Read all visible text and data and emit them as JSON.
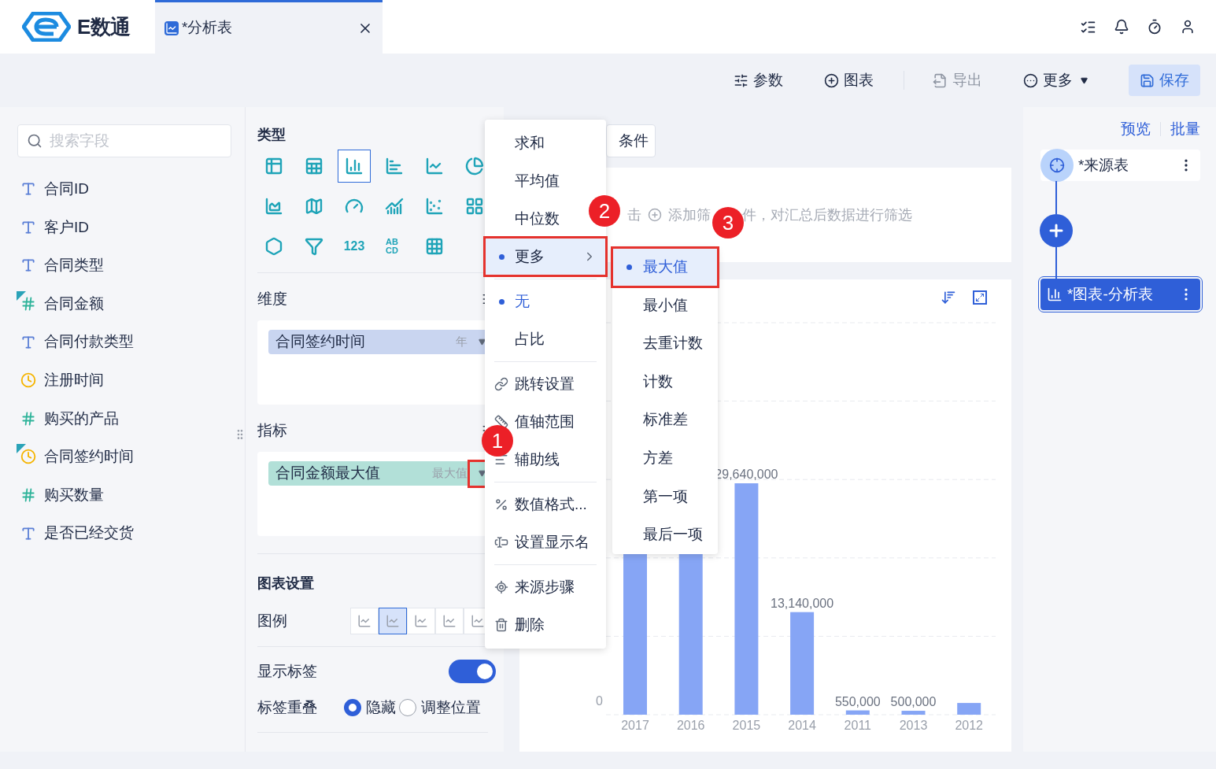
{
  "app": {
    "logo_text": "E数通"
  },
  "tabs": [
    {
      "label": "*分析表",
      "selected": true
    }
  ],
  "toolbar": {
    "buttons": [
      {
        "label": "参数",
        "kind": "params",
        "disabled": false
      },
      {
        "label": "图表",
        "kind": "add",
        "disabled": false
      },
      {
        "label": "导出",
        "kind": "export",
        "disabled": true
      },
      {
        "label": "更多",
        "kind": "more",
        "disabled": false
      },
      {
        "label": "保存",
        "kind": "save",
        "disabled": false
      }
    ]
  },
  "fields_panel": {
    "search": {
      "placeholder": "搜索字段"
    },
    "fields": [
      {
        "name": "合同ID",
        "kind": "text",
        "used": false
      },
      {
        "name": "客户ID",
        "kind": "text",
        "used": false
      },
      {
        "name": "合同类型",
        "kind": "text",
        "used": false
      },
      {
        "name": "合同金额",
        "kind": "number",
        "used": true
      },
      {
        "name": "合同付款类型",
        "kind": "text",
        "used": false
      },
      {
        "name": "注册时间",
        "kind": "date",
        "used": false
      },
      {
        "name": "购买的产品",
        "kind": "number",
        "used": false
      },
      {
        "name": "合同签约时间",
        "kind": "date",
        "used": true
      },
      {
        "name": "购买数量",
        "kind": "number",
        "used": false
      },
      {
        "name": "是否已经交货",
        "kind": "text",
        "used": false
      }
    ]
  },
  "config": {
    "type_title": "类型",
    "chart_types": [
      {
        "kind": "table",
        "selected": false
      },
      {
        "kind": "crosstable",
        "selected": false
      },
      {
        "kind": "column",
        "selected": true
      },
      {
        "kind": "bar",
        "selected": false
      },
      {
        "kind": "line",
        "selected": false
      },
      {
        "kind": "pie",
        "selected": false
      },
      {
        "kind": "area",
        "selected": false
      },
      {
        "kind": "map",
        "selected": false
      },
      {
        "kind": "gauge",
        "selected": false
      },
      {
        "kind": "combo",
        "selected": false
      },
      {
        "kind": "scatter",
        "selected": false
      },
      {
        "kind": "treemap",
        "selected": false
      },
      {
        "kind": "radar",
        "selected": false
      },
      {
        "kind": "funnel",
        "selected": false
      },
      {
        "kind": "number",
        "glyph": "123",
        "selected": false
      },
      {
        "kind": "wordcloud",
        "glyph": "ABCD",
        "selected": false
      },
      {
        "kind": "heatmap",
        "selected": false
      }
    ],
    "dimension": {
      "title": "维度",
      "pill": {
        "label": "合同签约时间",
        "detail": "年",
        "highlighted": false
      }
    },
    "measure": {
      "title": "指标",
      "pill": {
        "label": "合同金额最大值",
        "detail": "最大值",
        "highlighted": true
      }
    },
    "chart_settings": {
      "title": "图表设置",
      "legend": {
        "label": "图例",
        "options": [
          {
            "selected": false
          },
          {
            "selected": true
          },
          {
            "selected": false
          },
          {
            "selected": false
          },
          {
            "selected": false
          }
        ]
      },
      "show_labels": {
        "label": "显示标签",
        "on": true
      },
      "label_overlap": {
        "label": "标签重叠",
        "options": [
          {
            "label": "隐藏",
            "selected": true
          },
          {
            "label": "调整位置",
            "selected": false
          }
        ]
      }
    }
  },
  "filter": {
    "button": "条件",
    "hint_parts": [
      "击",
      "添加筛",
      "件，对汇总后数据进行筛选"
    ]
  },
  "chart": {
    "chart_data": {
      "type": "bar",
      "categories": [
        "2017",
        "2016",
        "2015",
        "2014",
        "2011",
        "2013",
        "2012"
      ],
      "values": [
        null,
        null,
        29640000,
        13140000,
        550000,
        500000,
        1500000
      ],
      "annotations": [
        "0"
      ],
      "value_labels": [
        null,
        null,
        "29,640,000",
        "13,140,000",
        "550,000",
        "500,000",
        null
      ]
    }
  },
  "flow": {
    "links": [
      "预览",
      "批量"
    ],
    "nodes": [
      {
        "label": "*来源表",
        "kind": "source",
        "selected": false
      },
      {
        "label": "*图表-分析表",
        "kind": "chart",
        "selected": true
      }
    ]
  },
  "aggregate_menu": {
    "groups": [
      [
        {
          "label": "求和",
          "kind": "option",
          "selected": false,
          "highlighted": false
        },
        {
          "label": "平均值",
          "kind": "option",
          "selected": false,
          "highlighted": false
        },
        {
          "label": "中位数",
          "kind": "option",
          "selected": false,
          "highlighted": false
        },
        {
          "label": "更多",
          "kind": "submenu",
          "selected": true,
          "highlighted": true
        }
      ],
      [
        {
          "label": "无",
          "kind": "option",
          "selected": true,
          "highlighted": false
        },
        {
          "label": "占比",
          "kind": "option",
          "selected": false,
          "highlighted": false
        }
      ],
      [
        {
          "label": "跳转设置",
          "kind": "link",
          "selected": false,
          "highlighted": false
        },
        {
          "label": "值轴范围",
          "kind": "range",
          "selected": false,
          "highlighted": false
        },
        {
          "label": "辅助线",
          "kind": "guide",
          "selected": false,
          "highlighted": false
        }
      ],
      [
        {
          "label": "数值格式...",
          "kind": "format",
          "selected": false,
          "highlighted": false
        },
        {
          "label": "设置显示名",
          "kind": "rename",
          "selected": false,
          "highlighted": false
        }
      ],
      [
        {
          "label": "来源步骤",
          "kind": "source",
          "selected": false,
          "highlighted": false
        },
        {
          "label": "删除",
          "kind": "delete",
          "selected": false,
          "highlighted": false
        }
      ]
    ]
  },
  "submenu": {
    "items": [
      {
        "label": "最大值",
        "selected": true,
        "highlighted": true
      },
      {
        "label": "最小值",
        "selected": false,
        "highlighted": false
      },
      {
        "label": "去重计数",
        "selected": false,
        "highlighted": false
      },
      {
        "label": "计数",
        "selected": false,
        "highlighted": false
      },
      {
        "label": "标准差",
        "selected": false,
        "highlighted": false
      },
      {
        "label": "方差",
        "selected": false,
        "highlighted": false
      },
      {
        "label": "第一项",
        "selected": false,
        "highlighted": false
      },
      {
        "label": "最后一项",
        "selected": false,
        "highlighted": false
      }
    ]
  },
  "callouts": [
    "1",
    "2",
    "3"
  ]
}
